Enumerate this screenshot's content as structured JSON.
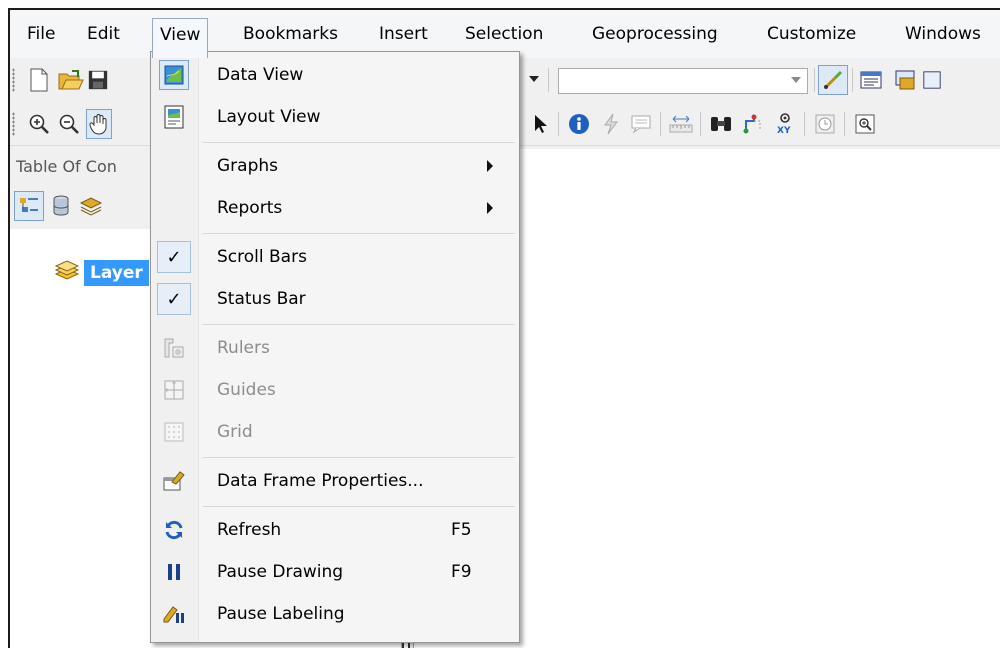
{
  "menubar": {
    "items": [
      "File",
      "Edit",
      "View",
      "Bookmarks",
      "Insert",
      "Selection",
      "Geoprocessing",
      "Customize",
      "Windows"
    ],
    "active": "View"
  },
  "toc": {
    "title": "Table Of Con",
    "layers_label": "Layer"
  },
  "view_menu": {
    "items": [
      {
        "label": "Data View",
        "icon": "data-view-icon"
      },
      {
        "label": "Layout View",
        "icon": "layout-view-icon"
      },
      {
        "label": "Graphs",
        "submenu": true
      },
      {
        "label": "Reports",
        "submenu": true
      },
      {
        "label": "Scroll Bars",
        "checked": true
      },
      {
        "label": "Status Bar",
        "checked": true
      },
      {
        "label": "Rulers",
        "disabled": true,
        "icon": "rulers-icon"
      },
      {
        "label": "Guides",
        "disabled": true,
        "icon": "guides-icon"
      },
      {
        "label": "Grid",
        "disabled": true,
        "icon": "grid-icon"
      },
      {
        "label": "Data Frame Properties...",
        "icon": "data-frame-properties-icon"
      },
      {
        "label": "Refresh",
        "shortcut": "F5",
        "icon": "refresh-icon"
      },
      {
        "label": "Pause Drawing",
        "shortcut": "F9",
        "icon": "pause-drawing-icon"
      },
      {
        "label": "Pause Labeling",
        "icon": "pause-labeling-icon"
      }
    ]
  },
  "colors": {
    "selection_blue": "#3399ff",
    "menu_border": "#979797"
  }
}
